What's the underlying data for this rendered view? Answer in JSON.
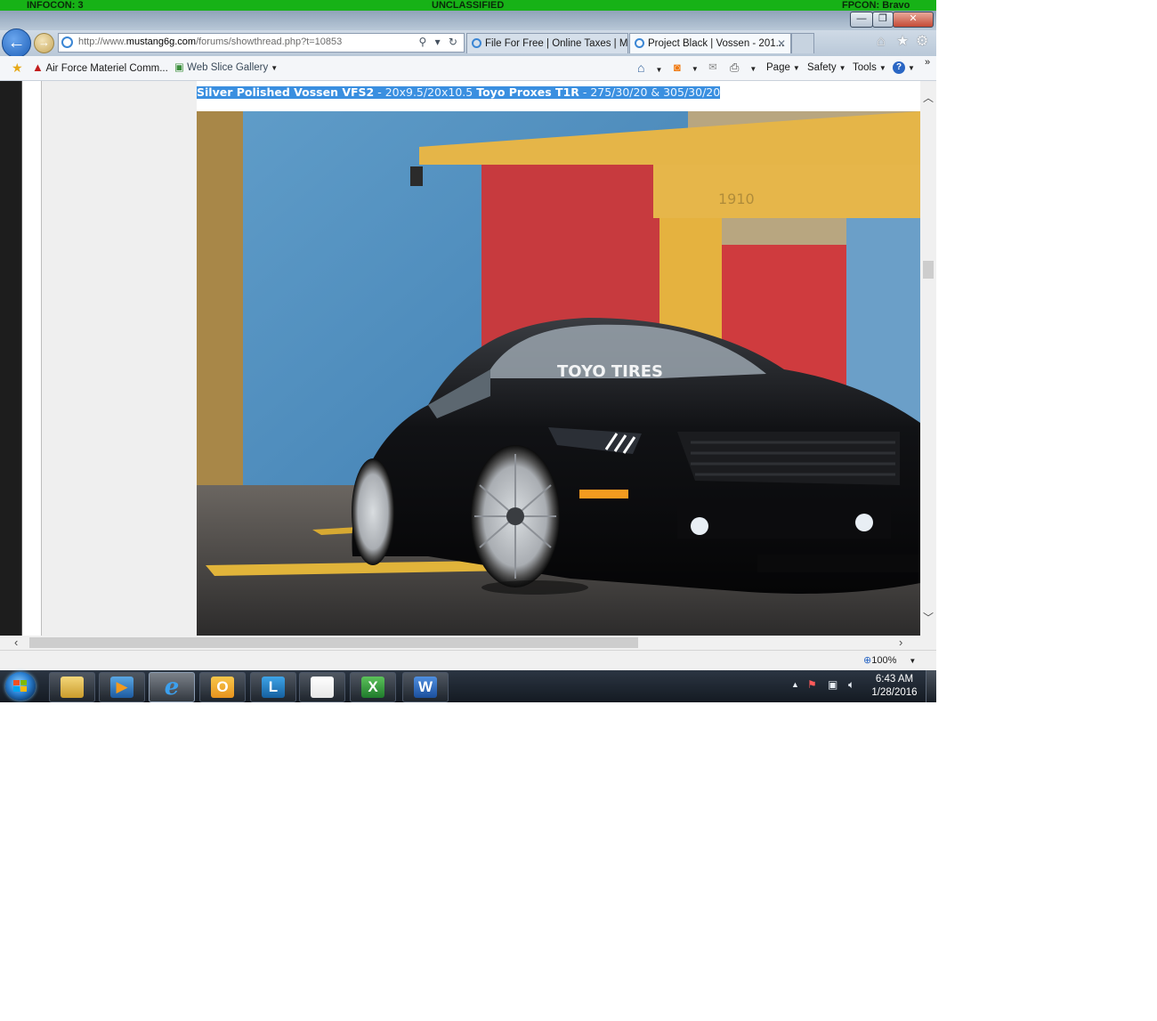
{
  "banner": {
    "left": "INFOCON: 3",
    "center": "UNCLASSIFIED",
    "right": "FPCON: Bravo"
  },
  "window_controls": {
    "minimize": "—",
    "restore": "❐",
    "close": "✕"
  },
  "address_bar": {
    "url_prefix": "http://www.",
    "url_domain": "mustang6g.com",
    "url_path": "/forums/showthread.php?t=10853",
    "tools": "⚲ ▾ ↻"
  },
  "tabs": [
    {
      "label": "File For Free | Online Taxes | M..."
    },
    {
      "label": "Project Black | Vossen - 201...",
      "close": "✕"
    }
  ],
  "nav_icons": {
    "home": "⌂",
    "favorites": "★",
    "settings": "⚙"
  },
  "favorites_bar": {
    "items": [
      {
        "label": "Air Force Materiel Comm..."
      },
      {
        "label": "Web Slice Gallery"
      }
    ]
  },
  "command_bar": {
    "page": "Page",
    "safety": "Safety",
    "tools": "Tools",
    "help": "?",
    "more": "»"
  },
  "caption": {
    "brand1": "Silver Polished Vossen VFS2",
    "sep1": " - 20x9.5/20x10.5 ",
    "brand2": "Toyo Proxes T1R",
    "sep2": " - 275/30/20 & 305/30/20"
  },
  "photo": {
    "building_number": "1910",
    "windshield_banner": "TOYO TIRES"
  },
  "status_bar": {
    "zoom": "100%"
  },
  "taskbar": {
    "apps": [
      {
        "name": "windows-explorer",
        "glyph": ""
      },
      {
        "name": "media-player",
        "glyph": "▶"
      },
      {
        "name": "internet-explorer",
        "glyph": "e"
      },
      {
        "name": "outlook",
        "glyph": "O"
      },
      {
        "name": "lync",
        "glyph": "L"
      },
      {
        "name": "adobe-reader",
        "glyph": ""
      },
      {
        "name": "excel",
        "glyph": "X"
      },
      {
        "name": "word",
        "glyph": "W"
      }
    ],
    "clock_time": "6:43 AM",
    "clock_date": "1/28/2016"
  },
  "colors": {
    "banner": "#17b217",
    "selection": "#3a8fe0",
    "taskbar": "#1d2530",
    "car": "#0e0f12"
  }
}
